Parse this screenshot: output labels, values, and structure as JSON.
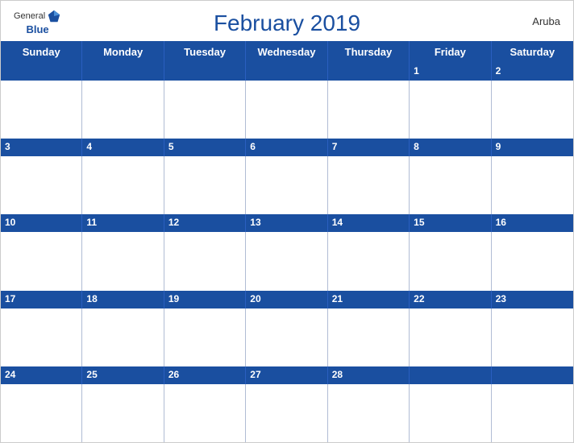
{
  "header": {
    "logo_general": "General",
    "logo_blue": "Blue",
    "title": "February 2019",
    "region": "Aruba"
  },
  "days": [
    "Sunday",
    "Monday",
    "Tuesday",
    "Wednesday",
    "Thursday",
    "Friday",
    "Saturday"
  ],
  "weeks": [
    {
      "dates": [
        "",
        "",
        "",
        "",
        "",
        "1",
        "2"
      ]
    },
    {
      "dates": [
        "3",
        "4",
        "5",
        "6",
        "7",
        "8",
        "9"
      ]
    },
    {
      "dates": [
        "10",
        "11",
        "12",
        "13",
        "14",
        "15",
        "16"
      ]
    },
    {
      "dates": [
        "17",
        "18",
        "19",
        "20",
        "21",
        "22",
        "23"
      ]
    },
    {
      "dates": [
        "24",
        "25",
        "26",
        "27",
        "28",
        "",
        ""
      ]
    }
  ],
  "colors": {
    "header_bg": "#1a4fa0",
    "header_text": "#ffffff",
    "date_text": "#1a4fa0",
    "grid_border": "#b0bcd4",
    "title_color": "#1a4fa0"
  }
}
